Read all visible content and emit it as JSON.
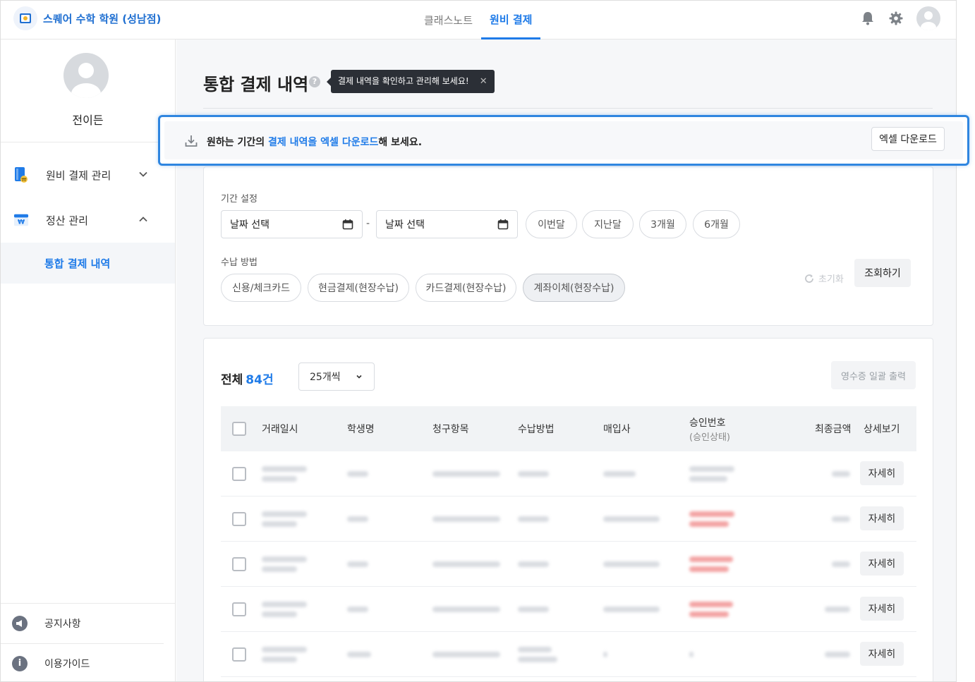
{
  "header": {
    "brand": "스퀘어 수학 학원 (성남점)",
    "nav": [
      {
        "label": "클래스노트",
        "active": false
      },
      {
        "label": "원비 결제",
        "active": true
      }
    ],
    "icons": [
      "bell-icon",
      "gear-icon",
      "user-avatar"
    ],
    "accent_color": "#1f7be8"
  },
  "sidebar": {
    "profile_name": "전이든",
    "menu": [
      {
        "label": "원비 결제 관리",
        "icon": "tuition-book-icon",
        "expanded": false
      },
      {
        "label": "정산 관리",
        "icon": "settlement-won-icon",
        "expanded": true
      }
    ],
    "submenu": {
      "label": "통합 결제 내역",
      "active": true
    },
    "bottom": [
      {
        "label": "공지사항",
        "icon": "megaphone-icon"
      },
      {
        "label": "이용가이드",
        "icon": "info-icon"
      }
    ]
  },
  "page": {
    "title": "통합 결제 내역",
    "tooltip": "결제 내역을 확인하고 관리해 보세요!",
    "tooltip_close": "✕"
  },
  "banner": {
    "text_before": "원하는 기간의 ",
    "text_highlight": "결제 내역을 엑셀 다운로드",
    "text_after": "해 보세요.",
    "button": "엑셀 다운로드"
  },
  "filter": {
    "period_label": "기간 설정",
    "start_placeholder": "날짜 선택",
    "end_placeholder": "날짜 선택",
    "separator": "-",
    "quick_ranges": [
      "이번달",
      "지난달",
      "3개월",
      "6개월"
    ],
    "method_label": "수납 방법",
    "methods": [
      {
        "label": "신용/체크카드",
        "active": false
      },
      {
        "label": "현금결제(현장수납)",
        "active": false
      },
      {
        "label": "카드결제(현장수납)",
        "active": false
      },
      {
        "label": "계좌이체(현장수납)",
        "active": true
      }
    ],
    "reset": "초기화",
    "search": "조회하기"
  },
  "list": {
    "total_label": "전체",
    "total_count": "84건",
    "page_size": "25개씩",
    "receipt_button": "영수증 일괄 출력",
    "columns": {
      "date": "거래일시",
      "student": "학생명",
      "item": "청구항목",
      "method": "수납방법",
      "acquirer": "매입사",
      "approval": "승인번호",
      "approval_sub": "(승인상태)",
      "amount": "최종금액",
      "detail": "상세보기"
    },
    "detail_label": "자세히",
    "rows": [
      {
        "approval_status": "normal"
      },
      {
        "approval_status": "cancelled"
      },
      {
        "approval_status": "cancelled"
      },
      {
        "approval_status": "cancelled"
      },
      {
        "approval_status": "none"
      }
    ]
  }
}
